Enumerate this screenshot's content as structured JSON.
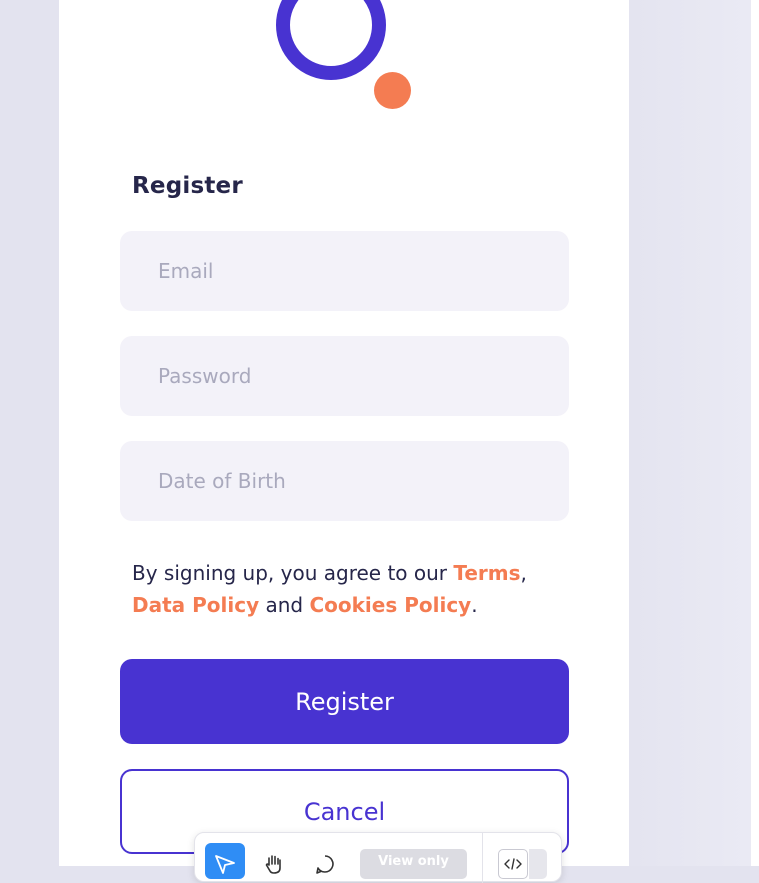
{
  "form": {
    "title": "Register",
    "fields": [
      {
        "placeholder": "Email",
        "value": ""
      },
      {
        "placeholder": "Password",
        "value": ""
      },
      {
        "placeholder": "Date of Birth",
        "value": ""
      }
    ],
    "terms": {
      "prefix": "By signing up, you agree to our ",
      "terms_link": "Terms",
      "comma": ",",
      "data_policy_link": "Data Policy",
      "and": " and ",
      "cookies_link": "Cookies Policy",
      "suffix": "."
    },
    "register_button": "Register",
    "cancel_button": "Cancel"
  },
  "toolbar": {
    "tools": [
      "pointer-icon",
      "hand-icon",
      "comment-icon"
    ],
    "view_only_label": "View only",
    "code_icon": "code-icon"
  },
  "colors": {
    "brand_primary": "#4833d1",
    "accent_orange": "#f47c52",
    "field_bg": "#f3f2f9",
    "text_dark": "#26264a",
    "placeholder": "#a9a9bd"
  }
}
